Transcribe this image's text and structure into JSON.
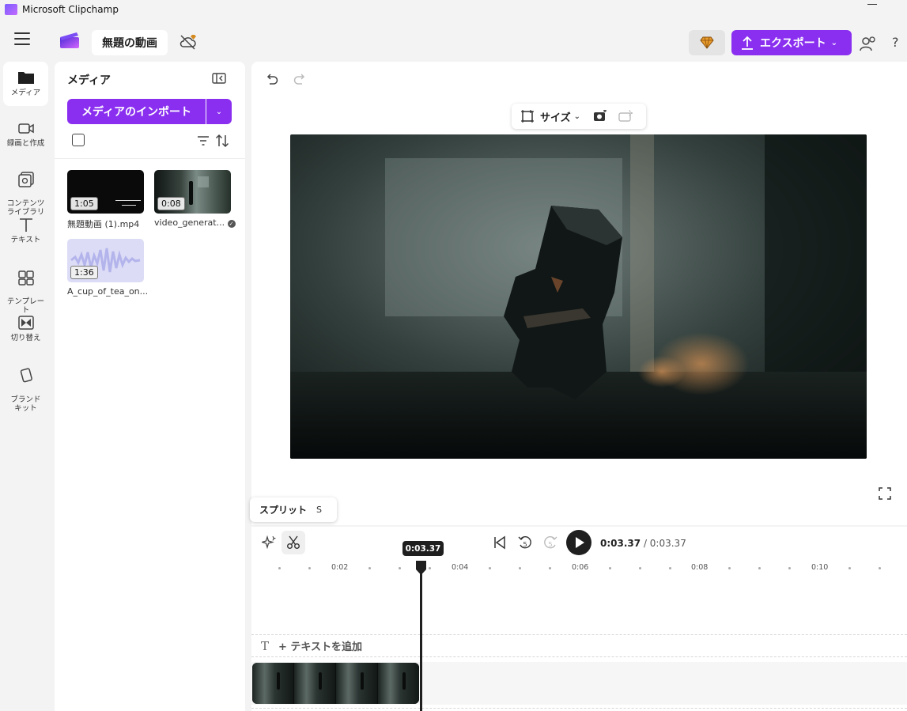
{
  "window": {
    "title": "Microsoft Clipchamp"
  },
  "header": {
    "project_title": "無題の動画",
    "export_label": "エクスポート"
  },
  "rail": {
    "items": [
      {
        "label": "メディア"
      },
      {
        "label": "録画と作成"
      },
      {
        "label": "コンテンツ\nライブラリ"
      },
      {
        "label": "テキスト"
      },
      {
        "label": "テンプレー\nト"
      },
      {
        "label": "切り替え"
      },
      {
        "label": "ブランド\nキット"
      }
    ]
  },
  "media": {
    "title": "メディア",
    "import_label": "メディアのインポート",
    "items": [
      {
        "name": "無題動画 (1).mp4",
        "duration": "1:05"
      },
      {
        "name": "video_generat...",
        "duration": "0:08"
      },
      {
        "name": "A_cup_of_tea_on...",
        "duration": "1:36"
      }
    ]
  },
  "preview": {
    "size_label": "サイズ"
  },
  "timeline": {
    "tooltip_label": "スプリット",
    "tooltip_key": "S",
    "current_time": "0:03.37",
    "total_time": "/ 0:03.37",
    "playhead_label": "0:03.37",
    "ruler_labels": [
      "0:02",
      "0:04",
      "0:06",
      "0:08",
      "0:10"
    ],
    "add_text_label": "+ テキストを追加",
    "skip_back_seconds": "5",
    "skip_fwd_seconds": "5"
  },
  "colors": {
    "accent": "#8a2ff0",
    "dark": "#1f1f1f",
    "background": "#f3f3f3"
  }
}
